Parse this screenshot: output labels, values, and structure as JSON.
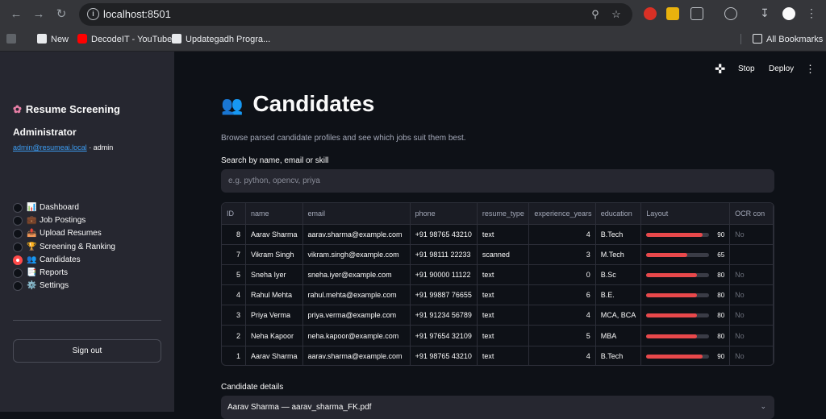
{
  "browser": {
    "url": "localhost:8501",
    "bookmarks": [
      {
        "label": "New"
      },
      {
        "label": "DecodeIT - YouTube"
      },
      {
        "label": "Updategadh Progra..."
      }
    ],
    "all_bookmarks": "All Bookmarks"
  },
  "sidebar": {
    "brand": "Resume Screening",
    "role": "Administrator",
    "email": "admin@resumeai.local",
    "email_suffix": " · admin",
    "nav": [
      {
        "label": "Dashboard",
        "icon": "📊",
        "selected": false
      },
      {
        "label": "Job Postings",
        "icon": "💼",
        "selected": false
      },
      {
        "label": "Upload Resumes",
        "icon": "📤",
        "selected": false
      },
      {
        "label": "Screening & Ranking",
        "icon": "🏆",
        "selected": false
      },
      {
        "label": "Candidates",
        "icon": "👥",
        "selected": true
      },
      {
        "label": "Reports",
        "icon": "📑",
        "selected": false
      },
      {
        "label": "Settings",
        "icon": "⚙️",
        "selected": false
      }
    ],
    "signout": "Sign out"
  },
  "header": {
    "stop": "Stop",
    "deploy": "Deploy"
  },
  "main": {
    "title": "Candidates",
    "title_icon": "👥",
    "subtitle": "Browse parsed candidate profiles and see which jobs suit them best.",
    "search_label": "Search by name, email or skill",
    "search_placeholder": "e.g. python, opencv, priya",
    "table": {
      "columns": [
        "ID",
        "name",
        "email",
        "phone",
        "resume_type",
        "experience_years",
        "education",
        "Layout",
        "OCR con"
      ],
      "rows": [
        {
          "id": "8",
          "name": "Aarav Sharma",
          "email": "aarav.sharma@example.com",
          "phone": "+91 98765 43210",
          "resume_type": "text",
          "experience_years": "4",
          "education": "B.Tech",
          "layout": 90,
          "ocr": "No"
        },
        {
          "id": "7",
          "name": "Vikram Singh",
          "email": "vikram.singh@example.com",
          "phone": "+91 98111 22233",
          "resume_type": "scanned",
          "experience_years": "3",
          "education": "M.Tech",
          "layout": 65,
          "ocr": ""
        },
        {
          "id": "5",
          "name": "Sneha Iyer",
          "email": "sneha.iyer@example.com",
          "phone": "+91 90000 11122",
          "resume_type": "text",
          "experience_years": "0",
          "education": "B.Sc",
          "layout": 80,
          "ocr": "No"
        },
        {
          "id": "4",
          "name": "Rahul Mehta",
          "email": "rahul.mehta@example.com",
          "phone": "+91 99887 76655",
          "resume_type": "text",
          "experience_years": "6",
          "education": "B.E.",
          "layout": 80,
          "ocr": "No"
        },
        {
          "id": "3",
          "name": "Priya Verma",
          "email": "priya.verma@example.com",
          "phone": "+91 91234 56789",
          "resume_type": "text",
          "experience_years": "4",
          "education": "MCA, BCA",
          "layout": 80,
          "ocr": "No"
        },
        {
          "id": "2",
          "name": "Neha Kapoor",
          "email": "neha.kapoor@example.com",
          "phone": "+91 97654 32109",
          "resume_type": "text",
          "experience_years": "5",
          "education": "MBA",
          "layout": 80,
          "ocr": "No"
        },
        {
          "id": "1",
          "name": "Aarav Sharma",
          "email": "aarav.sharma@example.com",
          "phone": "+91 98765 43210",
          "resume_type": "text",
          "experience_years": "4",
          "education": "B.Tech",
          "layout": 90,
          "ocr": "No"
        }
      ]
    },
    "details_label": "Candidate details",
    "details_value": "Aarav Sharma — aarav_sharma_FK.pdf"
  },
  "colors": {
    "accent": "#ff4b4b",
    "bar": "#e8484b",
    "link": "#3d9df3"
  }
}
